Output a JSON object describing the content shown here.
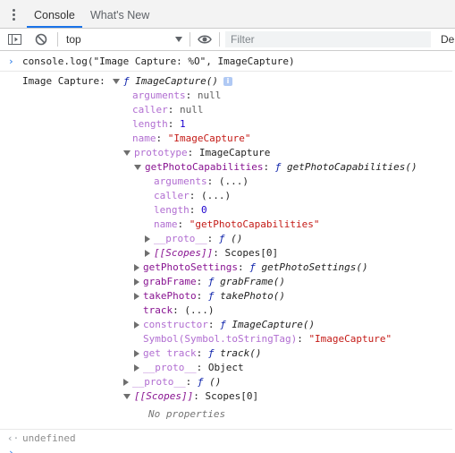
{
  "tabs": {
    "console": "Console",
    "whats_new": "What's New"
  },
  "toolbar": {
    "context": "top",
    "filter_placeholder": "Filter",
    "levels": "De"
  },
  "command": "console.log(\"Image Capture: %O\", ImageCapture)",
  "tree": {
    "label": "Image Capture: ",
    "root_f": "ƒ",
    "root_name": "ImageCapture()",
    "info_badge": "i",
    "arguments_key": "arguments",
    "arguments_val": "null",
    "caller_key": "caller",
    "caller_val": "null",
    "length_key": "length",
    "length_val": "1",
    "name_key": "name",
    "name_val": "\"ImageCapture\"",
    "prototype_key": "prototype",
    "prototype_val": "ImageCapture",
    "gpc_key": "getPhotoCapabilities",
    "gpc_f": "ƒ",
    "gpc_val": "getPhotoCapabilities()",
    "gpc_arguments_key": "arguments",
    "gpc_arguments_val": "(...)",
    "gpc_caller_key": "caller",
    "gpc_caller_val": "(...)",
    "gpc_length_key": "length",
    "gpc_length_val": "0",
    "gpc_name_key": "name",
    "gpc_name_val": "\"getPhotoCapabilities\"",
    "gpc_proto_key": "__proto__",
    "gpc_proto_f": "ƒ",
    "gpc_proto_val": "()",
    "gpc_scopes_key": "[[Scopes]]",
    "gpc_scopes_val": "Scopes[0]",
    "gps_key": "getPhotoSettings",
    "gps_f": "ƒ",
    "gps_val": "getPhotoSettings()",
    "grab_key": "grabFrame",
    "grab_f": "ƒ",
    "grab_val": "grabFrame()",
    "take_key": "takePhoto",
    "take_f": "ƒ",
    "take_val": "takePhoto()",
    "track_key": "track",
    "track_val": "(...)",
    "ctor_key": "constructor",
    "ctor_f": "ƒ",
    "ctor_val": "ImageCapture()",
    "symbol_key": "Symbol(Symbol.toStringTag)",
    "symbol_val": "\"ImageCapture\"",
    "gettrack_key": "get track",
    "gettrack_f": "ƒ",
    "gettrack_val": "track()",
    "proto_obj_key": "__proto__",
    "proto_obj_val": "Object",
    "root_proto_key": "__proto__",
    "root_proto_f": "ƒ",
    "root_proto_val": "()",
    "root_scopes_key": "[[Scopes]]",
    "root_scopes_val": "Scopes[0]",
    "no_props": "No properties",
    "sep": ": "
  },
  "result": "undefined",
  "colors": {
    "accent": "#1a73e8",
    "property": "#881391",
    "string": "#c41a16",
    "number": "#1c00cf",
    "function_keyword": "#0d22aa"
  },
  "icons": {
    "kebab": "more-vertical-icon",
    "sidebar": "sidebar-toggle-icon",
    "clear": "clear-console-icon",
    "eye": "live-expression-eye-icon"
  }
}
